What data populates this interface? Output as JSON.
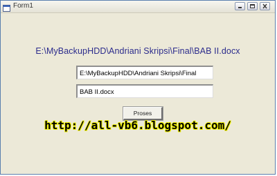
{
  "window": {
    "title": "Form1"
  },
  "main": {
    "full_path_label": "E:\\MyBackupHDD\\Andriani Skripsi\\Final\\BAB II.docx",
    "folder_field_value": "E:\\MyBackupHDD\\Andriani Skripsi\\Final",
    "file_field_value": "BAB II.docx",
    "proses_button_label": "Proses",
    "watermark_text": "http://all-vb6.blogspot.com/"
  },
  "icons": {
    "app": "form-window-icon",
    "minimize": "minimize-icon",
    "maximize": "maximize-icon",
    "close": "close-icon"
  },
  "colors": {
    "label_text": "#2b2b8c",
    "watermark_glow": "#f2f200",
    "form_background": "#ece9d8"
  }
}
